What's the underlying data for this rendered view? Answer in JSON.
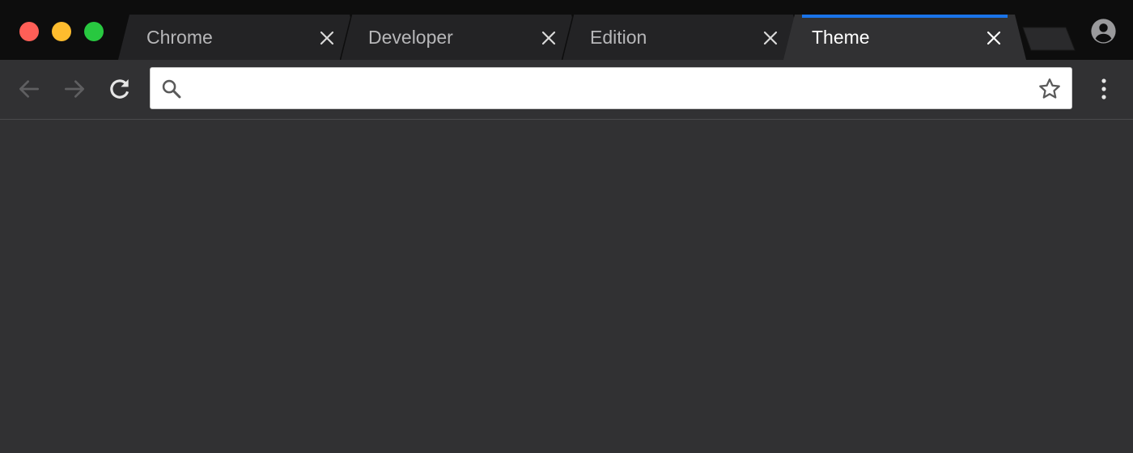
{
  "window": {
    "controls": {
      "close_color": "#ff5f57",
      "minimize_color": "#febc2e",
      "maximize_color": "#28c840"
    }
  },
  "tabs": [
    {
      "label": "Chrome",
      "active": false
    },
    {
      "label": "Developer",
      "active": false
    },
    {
      "label": "Edition",
      "active": false
    },
    {
      "label": "Theme",
      "active": true
    }
  ],
  "tabstrip": {
    "accent_color": "#1a73e8",
    "background_color": "#0d0d0d",
    "inactive_tab_color": "#232325",
    "active_tab_color": "#313133"
  },
  "toolbar": {
    "back_icon": "arrow-left-icon",
    "forward_icon": "arrow-right-icon",
    "reload_icon": "reload-icon",
    "menu_icon": "vertical-dots-icon"
  },
  "omnibox": {
    "value": "",
    "placeholder": "",
    "search_icon": "search-icon",
    "bookmark_icon": "star-outline-icon"
  },
  "profile": {
    "icon": "account-circle-icon"
  },
  "content": {
    "background_color": "#313133"
  }
}
